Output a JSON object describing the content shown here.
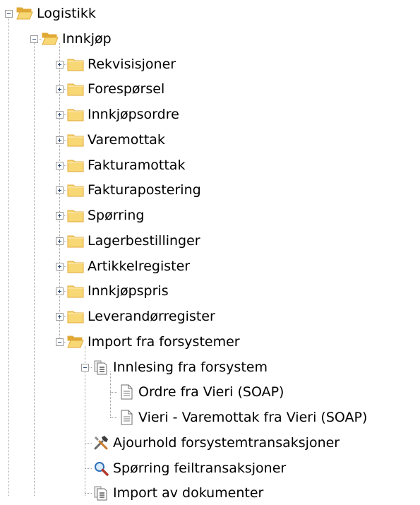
{
  "tree": [
    {
      "label": "Logistikk",
      "icon": "folder-open-icon",
      "level": 0,
      "expander": "minus",
      "clipped": false
    },
    {
      "label": "Innkjøp",
      "icon": "folder-open-icon",
      "level": 1,
      "expander": "minus",
      "clipped": false
    },
    {
      "label": "Rekvisisjoner",
      "icon": "folder-icon",
      "level": 2,
      "expander": "plus",
      "clipped": false
    },
    {
      "label": "Forespørsel",
      "icon": "folder-icon",
      "level": 2,
      "expander": "plus",
      "clipped": false
    },
    {
      "label": "Innkjøpsordre",
      "icon": "folder-icon",
      "level": 2,
      "expander": "plus",
      "clipped": false
    },
    {
      "label": "Varemottak",
      "icon": "folder-icon",
      "level": 2,
      "expander": "plus",
      "clipped": false
    },
    {
      "label": "Fakturamottak",
      "icon": "folder-icon",
      "level": 2,
      "expander": "plus",
      "clipped": false
    },
    {
      "label": "Fakturapostering",
      "icon": "folder-icon",
      "level": 2,
      "expander": "plus",
      "clipped": false
    },
    {
      "label": "Spørring",
      "icon": "folder-icon",
      "level": 2,
      "expander": "plus",
      "clipped": false
    },
    {
      "label": "Lagerbestillinger",
      "icon": "folder-icon",
      "level": 2,
      "expander": "plus",
      "clipped": false
    },
    {
      "label": "Artikkelregister",
      "icon": "folder-icon",
      "level": 2,
      "expander": "plus",
      "clipped": false
    },
    {
      "label": "Innkjøpspris",
      "icon": "folder-icon",
      "level": 2,
      "expander": "plus",
      "clipped": false
    },
    {
      "label": "Leverandørregister",
      "icon": "folder-icon",
      "level": 2,
      "expander": "plus",
      "clipped": false
    },
    {
      "label": "Import fra forsystemer",
      "icon": "folder-open-icon",
      "level": 2,
      "expander": "minus",
      "clipped": false
    },
    {
      "label": "Innlesing fra forsystem",
      "icon": "document-stack-icon",
      "level": 3,
      "expander": "minus",
      "clipped": false
    },
    {
      "label": "Ordre fra Vieri (SOAP)",
      "icon": "document-icon",
      "level": 4,
      "expander": "none",
      "clipped": false
    },
    {
      "label": "Vieri - Varemottak fra Vieri (SOAP)",
      "icon": "document-icon",
      "level": 4,
      "expander": "none",
      "clipped": false
    },
    {
      "label": "Ajourhold forsystemtransaksjoner",
      "icon": "tools-icon",
      "level": 3,
      "expander": "none",
      "clipped": false
    },
    {
      "label": "Spørring feiltransaksjoner",
      "icon": "magnifier-icon",
      "level": 3,
      "expander": "none",
      "clipped": false
    },
    {
      "label": "Import av dokumenter",
      "icon": "document-stack-icon",
      "level": 3,
      "expander": "none",
      "clipped": true
    }
  ],
  "colors": {
    "folder_fill": "#f8d775",
    "folder_dark": "#e0a936",
    "connector": "#a0a0a0",
    "expander_border": "#9a9a9a",
    "expander_sign": "#2f4f7f",
    "text": "#000000",
    "background": "#ffffff"
  }
}
